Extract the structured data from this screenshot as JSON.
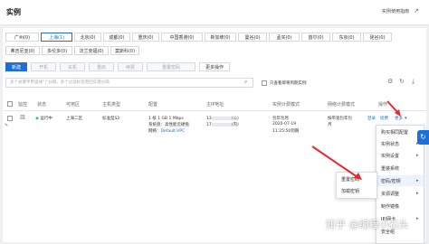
{
  "header": {
    "title": "实例",
    "help_link": "实例使用指南"
  },
  "regions": [
    "广州(0)",
    "上海(1)",
    "北京(0)",
    "成都(0)",
    "重庆(0)",
    "中国香港(0)",
    "新加坡(0)",
    "曼谷(0)",
    "孟买(0)",
    "首尔(0)",
    "东京(0)",
    "硅谷(0)",
    "弗吉尼亚(0)",
    "多伦多(0)",
    "法兰克福(0)",
    "莫斯科(0)"
  ],
  "toolbar": {
    "new": "新建",
    "start": "开机",
    "stop": "关机",
    "restart": "重启",
    "renew": "续费",
    "reset_password": "重置密码",
    "more_ops": "更多操作"
  },
  "search": {
    "placeholder": "多个关键字用竖线“|”分隔，多个过滤标签用回车键分隔",
    "only_show_expiring": "只查看即将到期实例"
  },
  "table": {
    "headers": [
      "监控",
      "状态",
      "可用区",
      "主机类型",
      "配置",
      "主IP地址",
      "实例计费模式",
      "网络计费模式",
      "操作"
    ],
    "row": {
      "status": "运行中",
      "zone": "上海二区",
      "type": "标准型S2",
      "config_line1": "1 核 1 GB 1 Mbps",
      "config_line2": "系统盘：高性能云硬盘",
      "network_label": "网络：",
      "network_value": "Default-VPC",
      "ip_public": "13",
      "ip_public_note": "(公)",
      "ip_private": "17",
      "ip_private_note": "(内)",
      "billing_line1": "包年包月",
      "billing_line2": "2020-07-19",
      "billing_line3": "11:25:50到期",
      "net_billing_line1": "按带宽包年包",
      "net_billing_line2": "月",
      "op_login": "登录",
      "op_renew": "续费",
      "op_more": "更多"
    }
  },
  "more_menu": [
    "购买相同配置",
    "实例状态",
    "实例设置",
    "重装系统",
    "密码/密钥",
    "资源调整",
    "制作镜像",
    "IP/网卡",
    "安全组"
  ],
  "submenu": [
    "重置密码",
    "加载密钥"
  ],
  "watermark": "知乎 @编程小石头"
}
